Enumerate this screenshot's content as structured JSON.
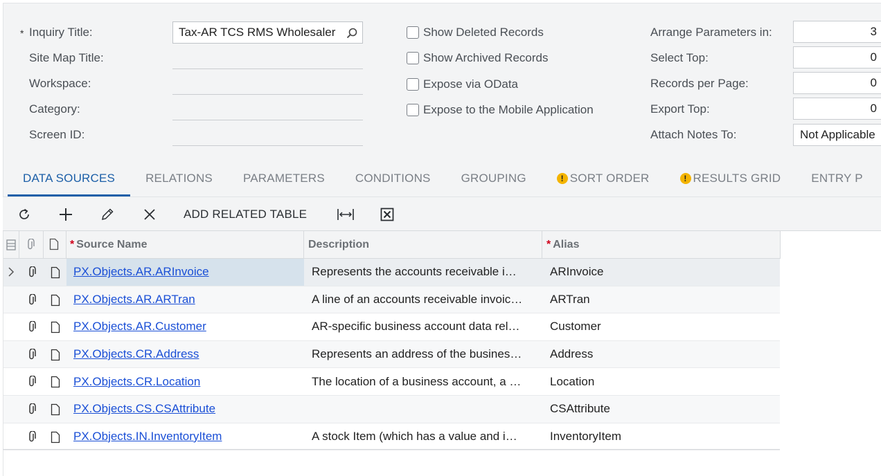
{
  "form": {
    "inquiry_title_label": "Inquiry Title:",
    "required_mark": "*",
    "inquiry_title_value": "Tax-AR TCS RMS Wholesaler",
    "site_map_title_label": "Site Map Title:",
    "workspace_label": "Workspace:",
    "category_label": "Category:",
    "screen_id_label": "Screen ID:",
    "show_deleted_label": "Show Deleted Records",
    "show_archived_label": "Show Archived Records",
    "expose_odata_label": "Expose via OData",
    "expose_mobile_label": "Expose to the Mobile Application",
    "arrange_params_label": "Arrange Parameters in:",
    "arrange_params_value": "3",
    "select_top_label": "Select Top:",
    "select_top_value": "0",
    "records_per_page_label": "Records per Page:",
    "records_per_page_value": "0",
    "export_top_label": "Export Top:",
    "export_top_value": "0",
    "attach_notes_label": "Attach Notes To:",
    "attach_notes_value": "Not Applicable"
  },
  "tabs": [
    {
      "label": "DATA SOURCES",
      "active": true,
      "warning": false
    },
    {
      "label": "RELATIONS",
      "active": false,
      "warning": false
    },
    {
      "label": "PARAMETERS",
      "active": false,
      "warning": false
    },
    {
      "label": "CONDITIONS",
      "active": false,
      "warning": false
    },
    {
      "label": "GROUPING",
      "active": false,
      "warning": false
    },
    {
      "label": "SORT ORDER",
      "active": false,
      "warning": true
    },
    {
      "label": "RESULTS GRID",
      "active": false,
      "warning": true
    },
    {
      "label": "ENTRY P",
      "active": false,
      "warning": false
    }
  ],
  "toolbar": {
    "refresh_icon": "refresh-icon",
    "add_icon": "plus-icon",
    "edit_icon": "pencil-icon",
    "delete_icon": "close-icon",
    "add_related_label": "ADD RELATED TABLE",
    "fit_icon": "fit-columns-icon",
    "excel_icon": "excel-export-icon"
  },
  "grid": {
    "headers": {
      "source_name": "Source Name",
      "description": "Description",
      "alias": "Alias",
      "required_mark": "*"
    },
    "rows": [
      {
        "source": "PX.Objects.AR.ARInvoice",
        "description": "Represents the accounts receivable i…",
        "alias": "ARInvoice"
      },
      {
        "source": "PX.Objects.AR.ARTran",
        "description": "A line of an accounts receivable invoic…",
        "alias": "ARTran"
      },
      {
        "source": "PX.Objects.AR.Customer",
        "description": "AR-specific business account data rel…",
        "alias": "Customer"
      },
      {
        "source": "PX.Objects.CR.Address",
        "description": "Represents an address of the busines…",
        "alias": "Address"
      },
      {
        "source": "PX.Objects.CR.Location",
        "description": "The location of a business account, a …",
        "alias": "Location"
      },
      {
        "source": "PX.Objects.CS.CSAttribute",
        "description": "",
        "alias": "CSAttribute"
      },
      {
        "source": "PX.Objects.IN.InventoryItem",
        "description": "A stock Item (which has a value and i…",
        "alias": "InventoryItem"
      }
    ]
  },
  "colors": {
    "accent": "#1c5fa8",
    "link": "#1a4fd6",
    "warning": "#f4b400",
    "required": "#d0021b"
  }
}
